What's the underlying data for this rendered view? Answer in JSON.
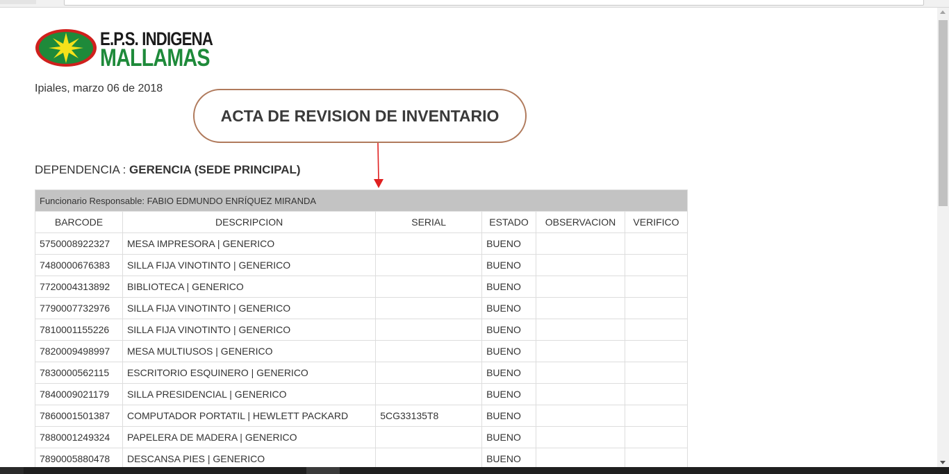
{
  "logo": {
    "line1": "E.P.S. INDIGENA",
    "line2": "MALLAMAS",
    "green": "#1e8a3a",
    "red": "#d0201d",
    "yellow": "#f5e21a"
  },
  "date_line": "Ipiales, marzo 06 de 2018",
  "callout": {
    "title": "ACTA DE REVISION DE INVENTARIO",
    "border_color": "#b07a5c",
    "arrow_color": "#e02020"
  },
  "dependencia": {
    "label": "DEPENDENCIA :",
    "value": "GERENCIA (SEDE PRINCIPAL)"
  },
  "table": {
    "responsible": "Funcionario Responsable: FABIO EDMUNDO ENRÍQUEZ MIRANDA",
    "headers": [
      "BARCODE",
      "DESCRIPCION",
      "SERIAL",
      "ESTADO",
      "OBSERVACION",
      "VERIFICO"
    ],
    "rows": [
      [
        "5750008922327",
        "MESA IMPRESORA | GENERICO",
        "",
        "BUENO",
        "",
        ""
      ],
      [
        "7480000676383",
        "SILLA FIJA VINOTINTO | GENERICO",
        "",
        "BUENO",
        "",
        ""
      ],
      [
        "7720004313892",
        "BIBLIOTECA | GENERICO",
        "",
        "BUENO",
        "",
        ""
      ],
      [
        "7790007732976",
        "SILLA FIJA VINOTINTO | GENERICO",
        "",
        "BUENO",
        "",
        ""
      ],
      [
        "7810001155226",
        "SILLA FIJA VINOTINTO | GENERICO",
        "",
        "BUENO",
        "",
        ""
      ],
      [
        "7820009498997",
        "MESA MULTIUSOS | GENERICO",
        "",
        "BUENO",
        "",
        ""
      ],
      [
        "7830000562115",
        "ESCRITORIO ESQUINERO | GENERICO",
        "",
        "BUENO",
        "",
        ""
      ],
      [
        "7840009021179",
        "SILLA PRESIDENCIAL | GENERICO",
        "",
        "BUENO",
        "",
        ""
      ],
      [
        "7860001501387",
        "COMPUTADOR PORTATIL | HEWLETT PACKARD",
        "5CG33135T8",
        "BUENO",
        "",
        ""
      ],
      [
        "7880001249324",
        "PAPELERA DE MADERA | GENERICO",
        "",
        "BUENO",
        "",
        ""
      ],
      [
        "7890005880478",
        "DESCANSA PIES | GENERICO",
        "",
        "BUENO",
        "",
        ""
      ]
    ]
  }
}
